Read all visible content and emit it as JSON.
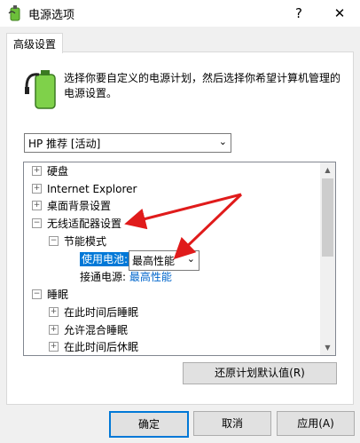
{
  "window": {
    "title": "电源选项",
    "help_glyph": "?",
    "close_glyph": "✕"
  },
  "tab": {
    "label": "高级设置"
  },
  "description": "选择你要自定义的电源计划，然后选择你希望计算机管理的电源设置。",
  "plan": {
    "selected": "HP 推荐 [活动]"
  },
  "tree": {
    "items": [
      {
        "label": "硬盘"
      },
      {
        "label": "Internet Explorer"
      },
      {
        "label": "桌面背景设置"
      },
      {
        "label": "无线适配器设置"
      },
      {
        "label": "节能模式"
      },
      {
        "label": "使用电池:",
        "value": "最高性能"
      },
      {
        "label": "接通电源:",
        "value": "最高性能"
      },
      {
        "label": "睡眠"
      },
      {
        "label": "在此时间后睡眠"
      },
      {
        "label": "允许混合睡眠"
      },
      {
        "label": "在此时间后休眠"
      }
    ]
  },
  "buttons": {
    "restore": "还原计划默认值(R)",
    "ok": "确定",
    "cancel": "取消",
    "apply": "应用(A)"
  },
  "colors": {
    "accent": "#0078d7",
    "annotation_arrow": "#e01b1b",
    "link": "#0066cc"
  },
  "icons": {
    "app": "power-options-icon",
    "battery": "battery-plug-icon"
  }
}
